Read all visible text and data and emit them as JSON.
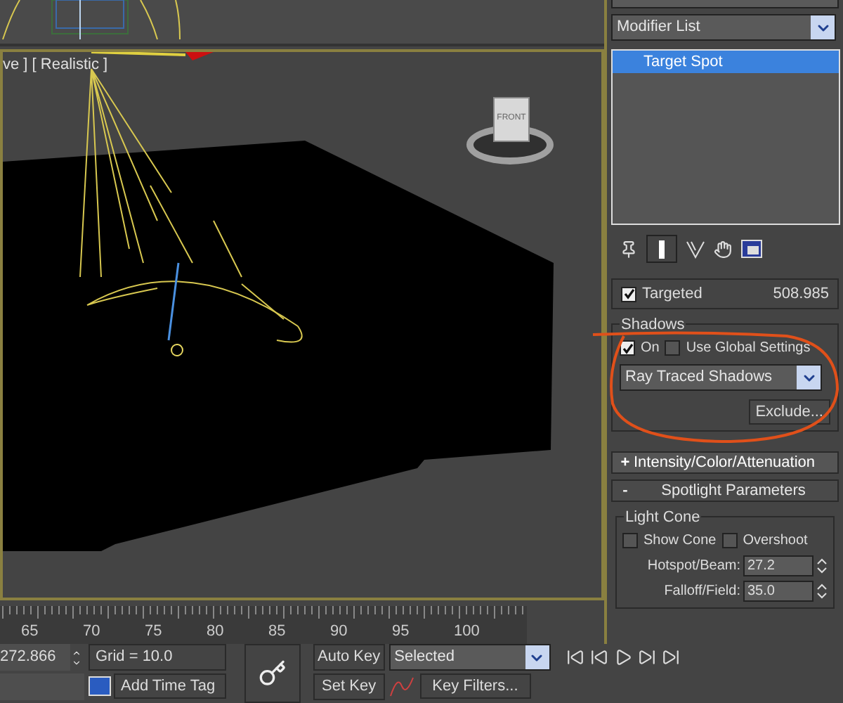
{
  "viewport": {
    "label": "ve ] [ Realistic ]",
    "viewcube_face": "FRONT"
  },
  "command_panel": {
    "modifier_list": "Modifier List",
    "modifier_stack": [
      {
        "label": "Target Spot",
        "selected": true
      }
    ],
    "targeted": {
      "label": "Targeted",
      "checked": true
    },
    "target_distance": "508.985",
    "shadows": {
      "title": "Shadows",
      "checks": [
        {
          "label": "On",
          "checked": true
        },
        {
          "label": "Use Global Settings",
          "checked": false
        }
      ],
      "type": "Ray Traced Shadows",
      "exclude": "Exclude..."
    },
    "rollouts": [
      {
        "sign": "+",
        "title": "Intensity/Color/Attenuation",
        "expanded": false
      },
      {
        "sign": "-",
        "title": "Spotlight Parameters",
        "expanded": true
      }
    ],
    "light_cone": {
      "title": "Light Cone",
      "checks": [
        {
          "label": "Show Cone",
          "checked": false
        },
        {
          "label": "Overshoot",
          "checked": false
        }
      ],
      "fields": [
        {
          "label": "Hotspot/Beam:",
          "value": "27.2"
        },
        {
          "label": "Falloff/Field:",
          "value": "35.0"
        }
      ]
    }
  },
  "timeline": {
    "ticks": [
      "65",
      "70",
      "75",
      "80",
      "85",
      "90",
      "95",
      "100"
    ]
  },
  "status_bar": {
    "coordinate": "272.866",
    "grid": "Grid = 10.0",
    "add_time_tag": "Add Time Tag",
    "auto_key": "Auto Key",
    "set_key": "Set Key",
    "key_mode": "Selected",
    "key_filters": "Key Filters..."
  }
}
